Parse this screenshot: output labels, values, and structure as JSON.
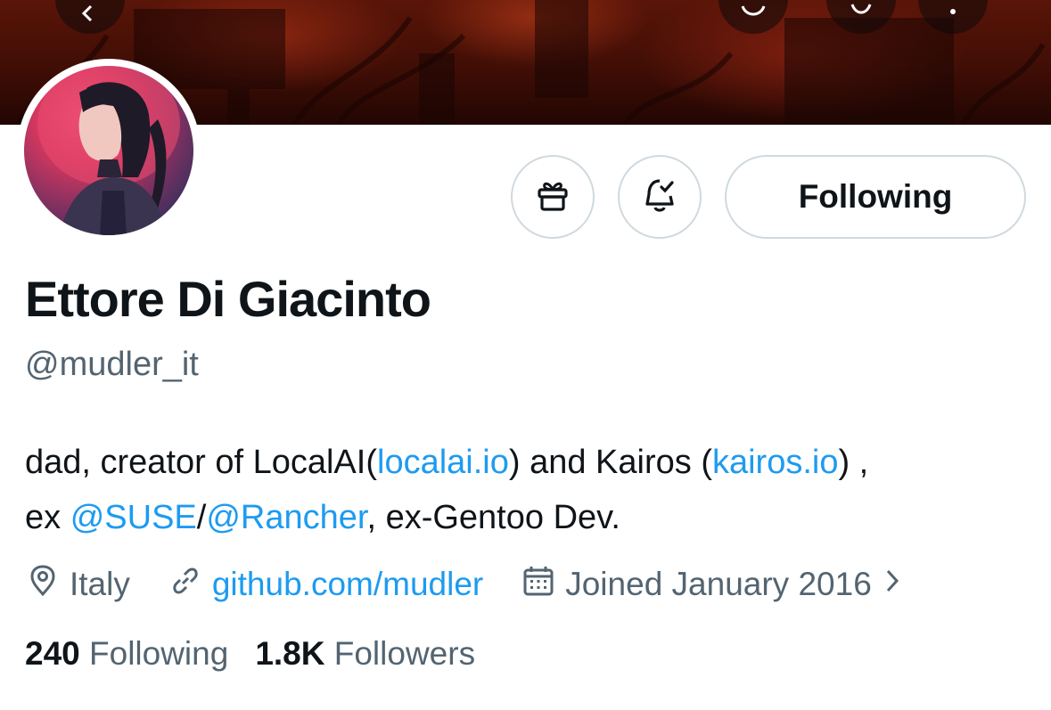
{
  "profile": {
    "name": "Ettore Di Giacinto",
    "handle": "@mudler_it",
    "follow_button_label": "Following"
  },
  "bio": {
    "part1": "dad, creator of LocalAI(",
    "link1": "localai.io",
    "part2": ") and Kairos (",
    "link2": "kairos.io",
    "part3": ") ,",
    "part4": "ex ",
    "mention1": "@SUSE",
    "sep": "/",
    "mention2": "@Rancher",
    "part5": ", ex-Gentoo Dev."
  },
  "meta": {
    "location": "Italy",
    "website": "github.com/mudler",
    "joined": "Joined January 2016"
  },
  "stats": {
    "following_count": "240",
    "following_label": "Following",
    "followers_count": "1.8K",
    "followers_label": "Followers"
  },
  "colors": {
    "link": "#1d9bf0",
    "secondary_text": "#536471",
    "primary_text": "#0f1419",
    "border": "#cfd9de"
  },
  "icons": [
    "back-arrow-icon",
    "repost-icon",
    "search-icon",
    "more-icon",
    "gift-icon",
    "notification-bell-check-icon",
    "location-pin-icon",
    "link-icon",
    "calendar-icon",
    "chevron-right-icon"
  ]
}
